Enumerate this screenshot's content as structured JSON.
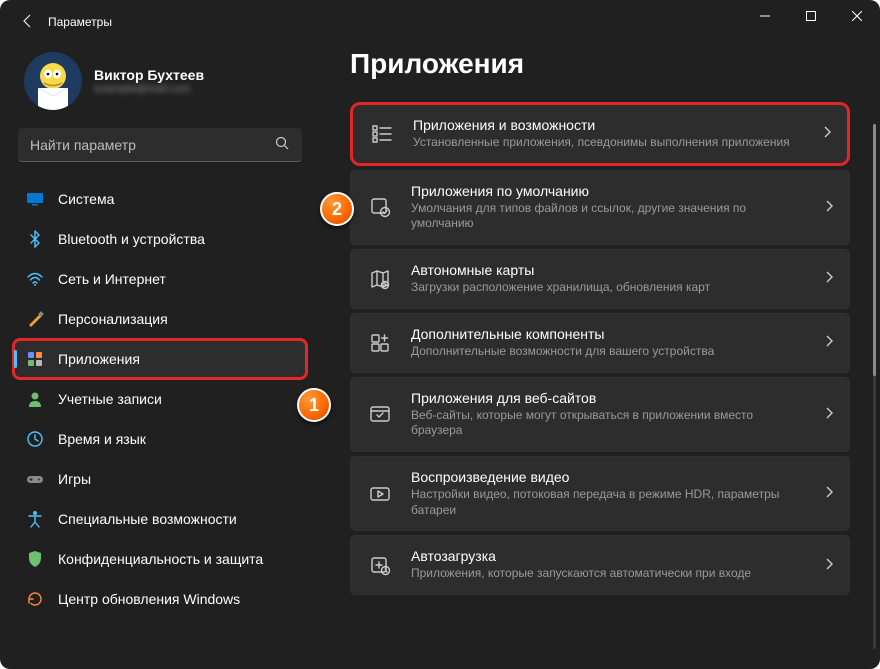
{
  "window": {
    "title": "Параметры"
  },
  "profile": {
    "name": "Виктор Бухтеев",
    "sub": "example@mail.com"
  },
  "search": {
    "placeholder": "Найти параметр"
  },
  "sidebar": {
    "items": [
      {
        "label": "Система",
        "icon": "display",
        "color": "#0078d4"
      },
      {
        "label": "Bluetooth и устройства",
        "icon": "bluetooth",
        "color": "#4cc2ff"
      },
      {
        "label": "Сеть и Интернет",
        "icon": "wifi",
        "color": "#4cc2ff"
      },
      {
        "label": "Персонализация",
        "icon": "brush",
        "color": "#e8a33d"
      },
      {
        "label": "Приложения",
        "icon": "apps",
        "color": "#8a8aff",
        "active": true,
        "highlighted": true
      },
      {
        "label": "Учетные записи",
        "icon": "person",
        "color": "#6fbf73"
      },
      {
        "label": "Время и язык",
        "icon": "clock",
        "color": "#4cc2ff"
      },
      {
        "label": "Игры",
        "icon": "gamepad",
        "color": "#8a8a8a"
      },
      {
        "label": "Специальные возможности",
        "icon": "accessibility",
        "color": "#4cc2ff"
      },
      {
        "label": "Конфиденциальность и защита",
        "icon": "shield",
        "color": "#6fbf73"
      },
      {
        "label": "Центр обновления Windows",
        "icon": "update",
        "color": "#ff8c42"
      }
    ]
  },
  "page": {
    "title": "Приложения"
  },
  "cards": [
    {
      "title": "Приложения и возможности",
      "sub": "Установленные приложения, псевдонимы выполнения приложения",
      "icon": "list",
      "highlighted": true
    },
    {
      "title": "Приложения по умолчанию",
      "sub": "Умолчания для типов файлов и ссылок, другие значения по умолчанию",
      "icon": "defaults"
    },
    {
      "title": "Автономные карты",
      "sub": "Загрузки расположение хранилища, обновления карт",
      "icon": "map"
    },
    {
      "title": "Дополнительные компоненты",
      "sub": "Дополнительные возможности для вашего устройства",
      "icon": "components"
    },
    {
      "title": "Приложения для веб-сайтов",
      "sub": "Веб-сайты, которые могут открываться в приложении вместо браузера",
      "icon": "websites"
    },
    {
      "title": "Воспроизведение видео",
      "sub": "Настройки видео, потоковая передача в режиме HDR, параметры батареи",
      "icon": "video"
    },
    {
      "title": "Автозагрузка",
      "sub": "Приложения, которые запускаются автоматически при входе",
      "icon": "startup"
    }
  ],
  "markers": {
    "1": "1",
    "2": "2"
  }
}
